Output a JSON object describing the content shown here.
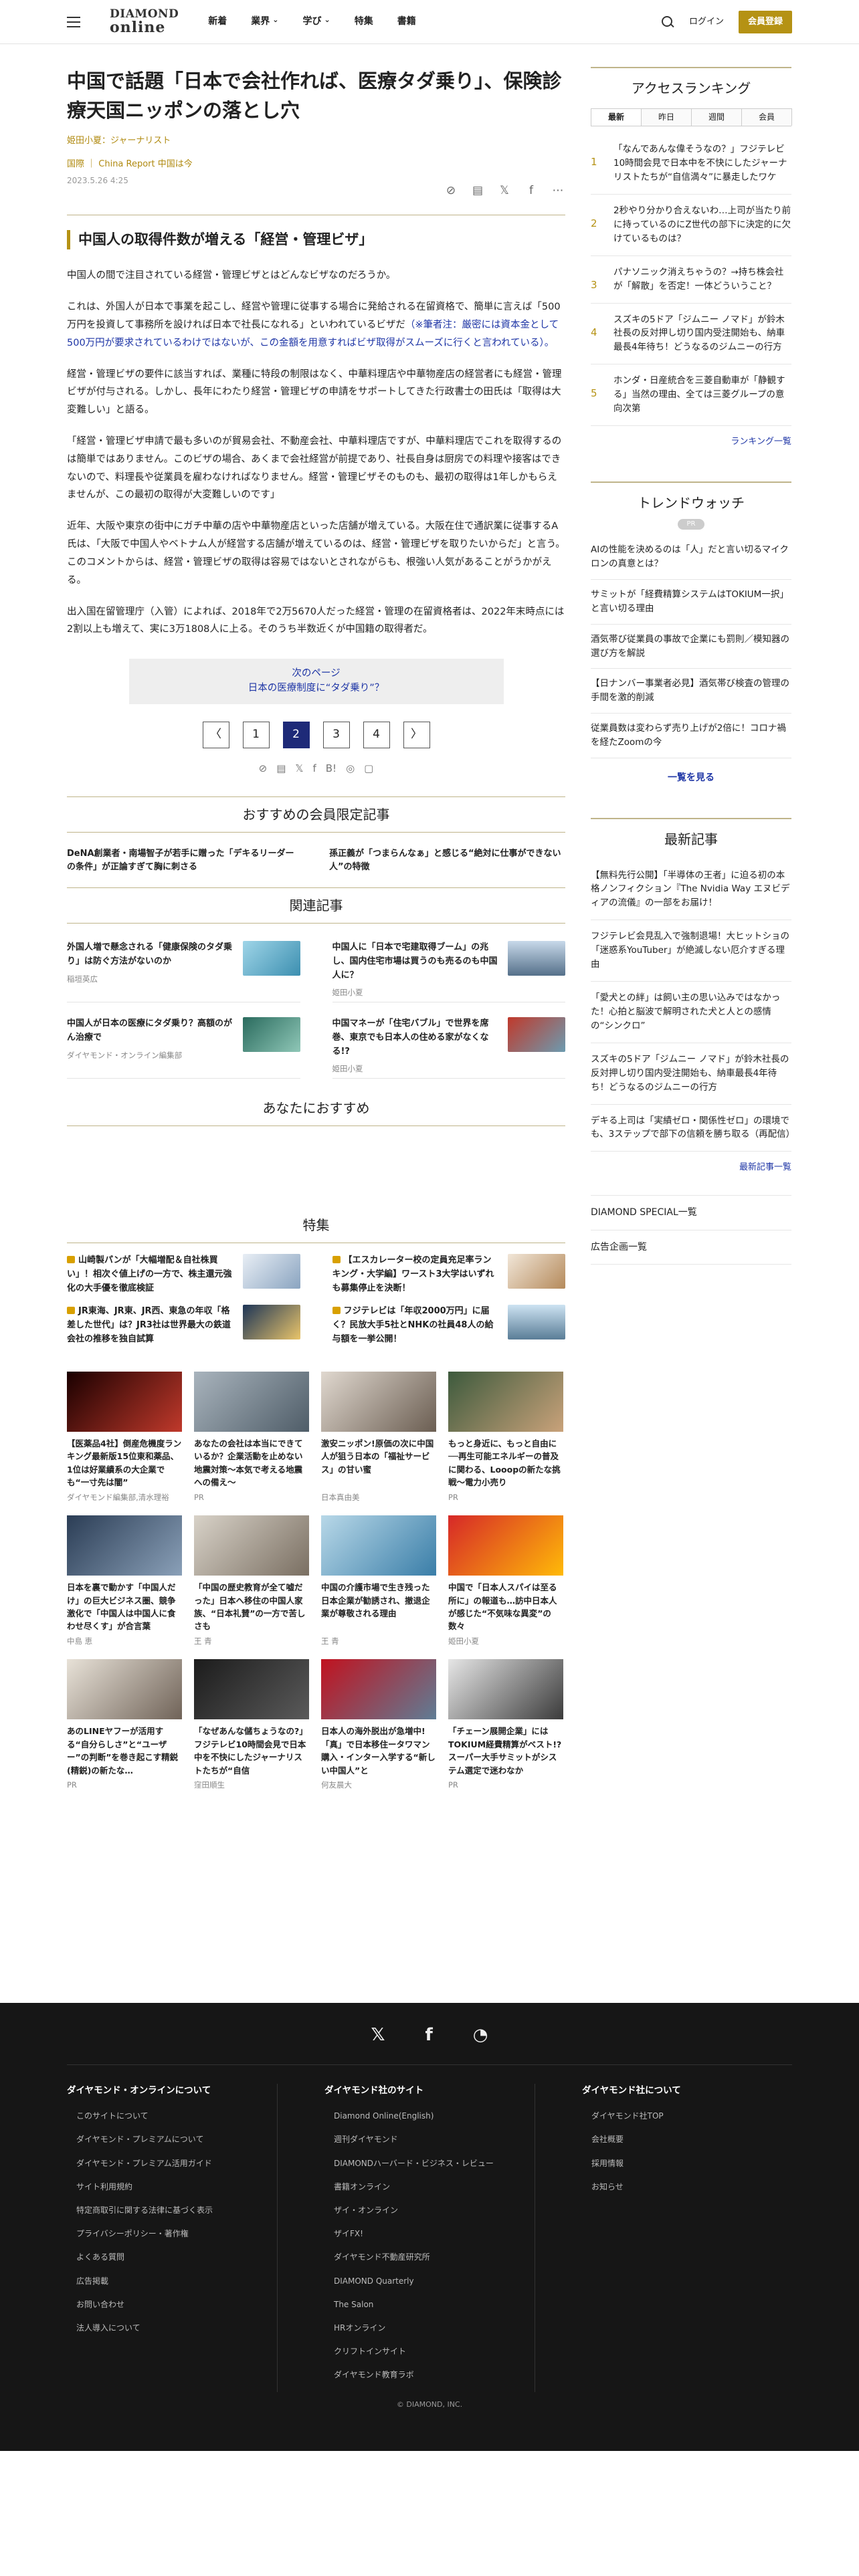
{
  "header": {
    "logo_top": "DIAMOND",
    "logo_bottom": "online",
    "nav": [
      "新着",
      "業界",
      "学び",
      "特集",
      "書籍"
    ],
    "login": "ログイン",
    "signup": "会員登録"
  },
  "article": {
    "title": "中国で話題「日本で会社作れば、医療タダ乗り」、保険診療天国ニッポンの落とし穴",
    "author": "姫田小夏：ジャーナリスト",
    "category": "国際 ｜ China Report 中国は今",
    "date": "2023.5.26 4:25",
    "heading": "中国人の取得件数が増える「経営・管理ビザ」",
    "paragraphs": [
      "中国人の間で注目されている経営・管理ビザとはどんなビザなのだろうか。",
      "これは、外国人が日本で事業を起こし、経営や管理に従事する場合に発給される在留資格で、簡単に言えば「500万円を投資して事務所を設ければ日本で社長になれる」といわれているビザだ",
      "経営・管理ビザの要件に該当すれば、業種に特段の制限はなく、中華料理店や中華物産店の経営者にも経営・管理ビザが付与される。しかし、長年にわたり経営・管理ビザの申請をサポートしてきた行政書士の田氏は「取得は大変難しい」と語る。",
      "「経営・管理ビザ申請で最も多いのが貿易会社、不動産会社、中華料理店ですが、中華料理店でこれを取得するのは簡単ではありません。このビザの場合、あくまで会社経営が前提であり、社長自身は厨房での料理や接客はできないので、料理長や従業員を雇わなければなりません。経営・管理ビザそのものも、最初の取得は1年しかもらえませんが、この最初の取得が大変難しいのです」",
      "近年、大阪や東京の街中にガチ中華の店や中華物産店といった店舗が増えている。大阪在住で通訳業に従事するA氏は、「大阪で中国人やベトナム人が経営する店舗が増えているのは、経営・管理ビザを取りたいからだ」と言う。このコメントからは、経営・管理ビザの取得は容易ではないとされながらも、根強い人気があることがうかがえる。",
      "出入国在留管理庁（入管）によれば、2018年で2万5670人だった経営・管理の在留資格者は、2022年末時点には2割以上も増えて、実に3万1808人に上る。そのうち半数近くが中国籍の取得者だ。"
    ],
    "note": "（※筆者注：厳密には資本金として500万円が要求されているわけではないが、この金額を用意すればビザ取得がスムーズに行くと言われている）。",
    "next_label": "次のページ",
    "next_title": "日本の医療制度に“タダ乗り”？",
    "pages": [
      "〈",
      "1",
      "2",
      "3",
      "4",
      "〉"
    ]
  },
  "member": {
    "title": "おすすめの会員限定記事",
    "items": [
      "DeNA創業者・南場智子が若手に贈った「デキるリーダーの条件」が正論すぎて胸に刺さる",
      "孫正義が「つまらんなぁ」と感じる“絶対に仕事ができない人”の特徴"
    ]
  },
  "related": {
    "title": "関連記事",
    "items": [
      {
        "t": "外国人増で懸念される「健康保険のタダ乗り」は防ぐ方法がないのか",
        "s": "稲垣英広"
      },
      {
        "t": "中国人に「日本で宅建取得ブーム」の兆し、国内住宅市場は買うのも売るのも中国人に？",
        "s": "姫田小夏"
      },
      {
        "t": "中国人が日本の医療にタダ乗り？高額のがん治療で",
        "s": "ダイヤモンド・オンライン編集部"
      },
      {
        "t": "中国マネーが「住宅バブル」で世界を席巻、東京でも日本人の住める家がなくなる!?",
        "s": "姫田小夏"
      }
    ]
  },
  "foryou": {
    "title": "あなたにおすすめ"
  },
  "special": {
    "title": "特集",
    "items": [
      "山崎製パンが「大幅増配＆自社株買い」！相次ぐ値上げの一方で、株主還元強化の大手優を徹底検証",
      "【エスカレーター校の定員充足率ランキング・大学編】ワースト3大学はいずれも募集停止を決断！",
      "JR東海、JR東、JR西、東急の年収「格差した世代」は？JR3社は世界最大の鉄道会社の推移を独自試算",
      "フジテレビは「年収2000万円」に届く？民放大手5社とNHKの社員48人の給与額を一挙公開！"
    ]
  },
  "cards": [
    {
      "t": "【医薬品4社】倒産危機度ランキング最新版15位東和薬品、1位は好業績系の大企業でも“一寸先は闇”",
      "s": "ダイヤモンド編集部,清水理裕"
    },
    {
      "t": "あなたの会社は本当にできているか？企業活動を止めない地震対策〜本気で考える地震への備え〜",
      "s": "PR"
    },
    {
      "t": "激安ニッポン!原価の次に中国人が狙う日本の「福祉サービス」の甘い蜜",
      "s": "日本真由美"
    },
    {
      "t": "もっと身近に、もっと自由に──再生可能エネルギーの普及に関わる、Looopの新たな挑戦～電力小売り",
      "s": "PR"
    },
    {
      "t": "日本を裏で動かす「中国人だけ」の巨大ビジネス圏、競争激化で「中国人は中国人に食わせ尽くす」が合言葉",
      "s": "中島 恵"
    },
    {
      "t": "「中国の歴史教育が全て嘘だった」日本へ移住の中国人家族、“日本礼賛”の一方で苦しさも",
      "s": "王 青"
    },
    {
      "t": "中国の介護市場で生き残った日本企業が勧誘され、撤退企業が尊敬される理由",
      "s": "王 青"
    },
    {
      "t": "中国で「日本人スパイは至る所に」の報道も…訪中日本人が感じた“不気味な異変”の数々",
      "s": "姫田小夏"
    },
    {
      "t": "あのLINEヤフーが活用する“自分らしさ”と“ユーザー”の判断”を巻き起こす精鋭(精鋭)の新たな…",
      "s": "PR"
    },
    {
      "t": "「なぜあんな儲ちょうなの?」フジテレビ10時間会見で日本中を不快にしたジャーナリストたちが“自信",
      "s": "窪田順生"
    },
    {
      "t": "日本人の海外脱出が急増中!「真」で日本移住ータワマン購入・インター入学する“新しい中国人”と",
      "s": "何友晨大"
    },
    {
      "t": "「チェーン展開企業」にはTOKIUM経費精算がベスト!?スーパー大手サミットがシステム選定で迷わなか",
      "s": "PR"
    }
  ],
  "ranking": {
    "title": "アクセスランキング",
    "tabs": [
      "最新",
      "昨日",
      "週間",
      "会員"
    ],
    "items": [
      "「なんであんな偉そうなの？」フジテレビ10時間会見で日本中を不快にしたジャーナリストたちが“自信満々”に暴走したワケ",
      "2秒やり分かり合えないわ…上司が当たり前に持っているのにZ世代の部下に決定的に欠けているものは？",
      "パナソニック消えちゃうの？→持ち株会社が「解散」を否定！一体どういうこと？",
      "スズキの5ドア「ジムニー ノマド」が鈴木社長の反対押し切り国内受注開始も、納車最長4年待ち！どうなるのジムニーの行方",
      "ホンダ・日産統合を三菱自動車が「静観する」当然の理由、全ては三菱グループの意向次第"
    ],
    "more": "ランキング一覧"
  },
  "trend": {
    "title": "トレンドウォッチ",
    "pr": "PR",
    "items": [
      "AIの性能を決めるのは「人」だと言い切るマイクロンの真意とは？",
      "サミットが「経費精算システムはTOKIUM一択」と言い切る理由",
      "酒気帯び従業員の事故で企業にも罰則／模知器の選び方を解説",
      "【日ナンバー事業者必見】酒気帯び検査の管理の手間を激的削減",
      "従業員数は変わらず売り上げが2倍に！コロナ禍を経たZoomの今"
    ],
    "more": "一覧を見る"
  },
  "news": {
    "title": "最新記事",
    "items": [
      "【無料先行公開】「半導体の王者」に迫る初の本格ノンフィクション『The Nvidia Way エヌビディアの流儀』の一部をお届け！",
      "フジテレビ会見乱入で強制退場！大ヒットショの「迷惑系YouTuber」が絶滅しない厄介すぎる理由",
      "「愛犬との絆」は飼い主の思い込みではなかった！心拍と脳波で解明された犬と人との感情の“シンクロ”",
      "スズキの5ドア「ジムニー ノマド」が鈴木社長の反対押し切り国内受注開始も、納車最長4年待ち！どうなるのジムニーの行方",
      "デキる上司は「実績ゼロ・関係性ゼロ」の環境でも、3ステップで部下の信頼を勝ち取る（再配信）"
    ],
    "more": "最新記事一覧"
  },
  "sidelinks": [
    "DIAMOND SPECIAL一覧",
    "広告企画一覧"
  ],
  "footer": {
    "col1": {
      "title": "ダイヤモンド・オンラインについて",
      "items": [
        "このサイトについて",
        "ダイヤモンド・プレミアムについて",
        "ダイヤモンド・プレミアム活用ガイド",
        "サイト利用規約",
        "特定商取引に関する法律に基づく表示",
        "プライバシーポリシー・著作権",
        "よくある質問",
        "広告掲載",
        "お問い合わせ",
        "法人導入について"
      ]
    },
    "col2": {
      "title": "ダイヤモンド社のサイト",
      "items": [
        "Diamond Online(English)",
        "週刊ダイヤモンド",
        "DIAMONDハーバード・ビジネス・レビュー",
        "書籍オンライン",
        "ザイ・オンライン",
        "ザイFX!",
        "ダイヤモンド不動産研究所",
        "DIAMOND Quarterly",
        "The Salon",
        "HRオンライン",
        "クリフトインサイト",
        "ダイヤモンド教育ラボ"
      ]
    },
    "col3": {
      "title": "ダイヤモンド社について",
      "items": [
        "ダイヤモンド社TOP",
        "会社概要",
        "採用情報",
        "お知らせ"
      ]
    },
    "copyright": "© DIAMOND, INC."
  }
}
